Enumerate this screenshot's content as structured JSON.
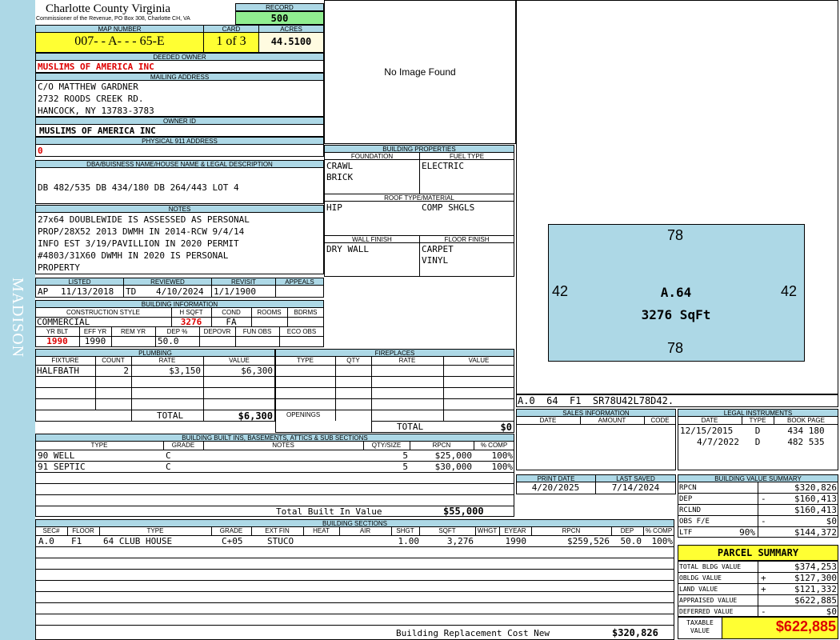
{
  "sidebar": {
    "district": "MADISON"
  },
  "header": {
    "county": "Charlotte County Virginia",
    "commissioner": "Commissioner of the Revenue, PO Box 308, Charlotte CH, VA"
  },
  "record": {
    "label": "RECORD",
    "value": "500"
  },
  "map": {
    "map_label": "MAP NUMBER",
    "map_value": "007-  - A-   -   - 65-E",
    "card_label": "CARD",
    "card_value": "1 of 3",
    "acres_label": "ACRES",
    "acres_value": "44.5100"
  },
  "owner": {
    "deeded_label": "DEEDED OWNER",
    "deeded_value": "MUSLIMS OF AMERICA INC",
    "mailing_label": "MAILING ADDRESS",
    "mail1": "C/O MATTHEW GARDNER",
    "mail2": "2732 ROODS CREEK RD.",
    "mail3": "HANCOCK, NY 13783-3783",
    "ownerid_label": "OWNER ID",
    "ownerid_value": "MUSLIMS OF AMERICA INC",
    "phys_label": "PHYSICAL 911 ADDRESS",
    "phys_value": "0"
  },
  "legal": {
    "label": "DBA/BUISNESS NAME/HOUSE NAME & LEGAL DESCRIPTION",
    "value": "DB 482/535 DB 434/180 DB 264/443 LOT 4"
  },
  "notes": {
    "label": "NOTES",
    "lines": [
      "27x64 DOUBLEWIDE IS ASSESSED AS PERSONAL",
      "PROP/28X52 2013 DWMH IN 2014-RCW 9/4/14",
      "INFO EST 3/19/PAVILLION IN 2020 PERMIT",
      "#4803/31X60 DWMH IN 2020 IS PERSONAL",
      "PROPERTY"
    ]
  },
  "status": {
    "listed_label": "LISTED",
    "reviewed_label": "REVIEWED",
    "revisit_label": "REVISIT",
    "appeals_label": "APPEALS",
    "listed_code": "AP",
    "listed_date": "11/13/2018",
    "reviewed_code": "TD",
    "reviewed_date": "4/10/2024",
    "revisit_date": "1/1/1900"
  },
  "building_info": {
    "label": "BUILDING INFORMATION",
    "cs_label": "CONSTRUCTION STYLE",
    "hsqft_label": "H SQFT",
    "cond_label": "COND",
    "rooms_label": "ROOMS",
    "bdrms_label": "BDRMS",
    "cs_value": "COMMERCIAL",
    "hsqft_value": "3276",
    "cond_value": "FA",
    "yrblt_label": "YR BLT",
    "effyr_label": "EFF YR",
    "remyr_label": "REM YR",
    "dep_label": "DEP %",
    "depovr_label": "DEPOVR",
    "funobs_label": "FUN OBS",
    "ecoobs_label": "ECO OBS",
    "yrblt_value": "1990",
    "effyr_value": "1990",
    "dep_value": "50.0"
  },
  "photo": {
    "text": "No Image Found"
  },
  "building_props": {
    "label": "BUILDING PROPERTIES",
    "foundation_label": "FOUNDATION",
    "fuel_label": "FUEL TYPE",
    "foundation1": "CRAWL",
    "foundation2": "BRICK",
    "fuel_value": "ELECTRIC",
    "roof_label": "ROOF TYPE/MATERIAL",
    "roof_type": "HIP",
    "roof_mat": "COMP SHGLS",
    "wall_label": "WALL FINISH",
    "floor_label": "FLOOR FINISH",
    "wall_value": "DRY WALL",
    "floor1": "CARPET",
    "floor2": "VINYL"
  },
  "sketch": {
    "top": "78",
    "bottom": "78",
    "left": "42",
    "right": "42",
    "name": "A.64",
    "area": "3276 SqFt",
    "vector": "A.0  64  F1  SR78U42L78D42."
  },
  "plumbing": {
    "label": "PLUMBING",
    "fixture_label": "FIXTURE",
    "count_label": "COUNT",
    "rate_label": "RATE",
    "value_label": "VALUE",
    "rows": [
      {
        "fixture": "HALFBATH",
        "count": "2",
        "rate": "$3,150",
        "value": "$6,300"
      }
    ],
    "total_label": "TOTAL",
    "total_value": "$6,300"
  },
  "fireplaces": {
    "label": "FIREPLACES",
    "type_label": "TYPE",
    "qty_label": "QTY",
    "rate_label": "RATE",
    "value_label": "VALUE",
    "openings_label": "OPENINGS",
    "total_label": "TOTAL",
    "total_value": "$0"
  },
  "builtins": {
    "label": "BUILDING BUILT INS, BASEMENTS, ATTICS & SUB SECTIONS",
    "type_label": "TYPE",
    "grade_label": "GRADE",
    "notes_label": "NOTES",
    "qty_label": "QTY/SIZE",
    "rpcn_label": "RPCN",
    "comp_label": "% COMP",
    "rows": [
      {
        "type": "90 WELL",
        "grade": "C",
        "qty": "5",
        "rpcn": "$25,000",
        "comp": "100%"
      },
      {
        "type": "91 SEPTIC",
        "grade": "C",
        "qty": "5",
        "rpcn": "$30,000",
        "comp": "100%"
      }
    ],
    "total_label": "Total Built In Value",
    "total_value": "$55,000"
  },
  "sections": {
    "label": "BUILDING SECTIONS",
    "sec_label": "SEC#",
    "floor_label": "FLOOR",
    "type_label": "TYPE",
    "grade_label": "GRADE",
    "extfin_label": "EXT FIN",
    "heat_label": "HEAT",
    "air_label": "AIR",
    "shgt_label": "SHGT",
    "sqft_label": "SQFT",
    "whgt_label": "WHGT",
    "eyear_label": "EYEAR",
    "rpcn_label": "RPCN",
    "dep_label": "DEP",
    "comp_label": "% COMP",
    "rows": [
      {
        "sec": "A.0",
        "floor": "F1",
        "type": "64 CLUB HOUSE",
        "grade": "C+05",
        "extfin": "STUCO",
        "shgt": "1.00",
        "sqft": "3,276",
        "eyear": "1990",
        "rpcn": "$259,526",
        "dep": "50.0",
        "comp": "100%"
      }
    ],
    "total_label": "Building Replacement Cost New",
    "total_value": "$320,826"
  },
  "sales": {
    "label": "SALES INFORMATION",
    "date_label": "DATE",
    "amount_label": "AMOUNT",
    "code_label": "CODE"
  },
  "legal_inst": {
    "label": "LEGAL INSTRUMENTS",
    "date_label": "DATE",
    "type_label": "TYPE",
    "bookpage_label": "BOOK PAGE",
    "rows": [
      {
        "date": "12/15/2015",
        "type": "D",
        "book": "434 180"
      },
      {
        "date": "4/7/2022",
        "type": "D",
        "book": "482 535"
      }
    ]
  },
  "print": {
    "print_label": "PRINT DATE",
    "saved_label": "LAST SAVED",
    "print_value": "4/20/2025",
    "saved_value": "7/14/2024"
  },
  "bvs": {
    "label": "BUILDING VALUE SUMMARY",
    "rows": [
      {
        "name": "RPCN",
        "sign": "",
        "pct": "",
        "value": "$320,826"
      },
      {
        "name": "DEP",
        "sign": "-",
        "pct": "",
        "value": "$160,413"
      },
      {
        "name": "RCLND",
        "sign": "",
        "pct": "",
        "value": "$160,413"
      },
      {
        "name": "OBS F/E",
        "sign": "-",
        "pct": "",
        "value": "$0"
      },
      {
        "name": "LTF",
        "sign": "",
        "pct": "90%",
        "value": "$144,372"
      }
    ]
  },
  "parcel": {
    "label": "PARCEL SUMMARY",
    "rows": [
      {
        "name": "TOTAL BLDG VALUE",
        "sign": "",
        "value": "$374,253"
      },
      {
        "name": "OBLDG VALUE",
        "sign": "+",
        "value": "$127,300"
      },
      {
        "name": "LAND VALUE",
        "sign": "+",
        "value": "$121,332"
      },
      {
        "name": "APPRAISED VALUE",
        "sign": "",
        "value": "$622,885"
      },
      {
        "name": "DEFERRED VALUE",
        "sign": "-",
        "value": "$0"
      }
    ],
    "taxable_label1": "TAXABLE",
    "taxable_label2": "VALUE",
    "taxable_value": "$622,885"
  }
}
